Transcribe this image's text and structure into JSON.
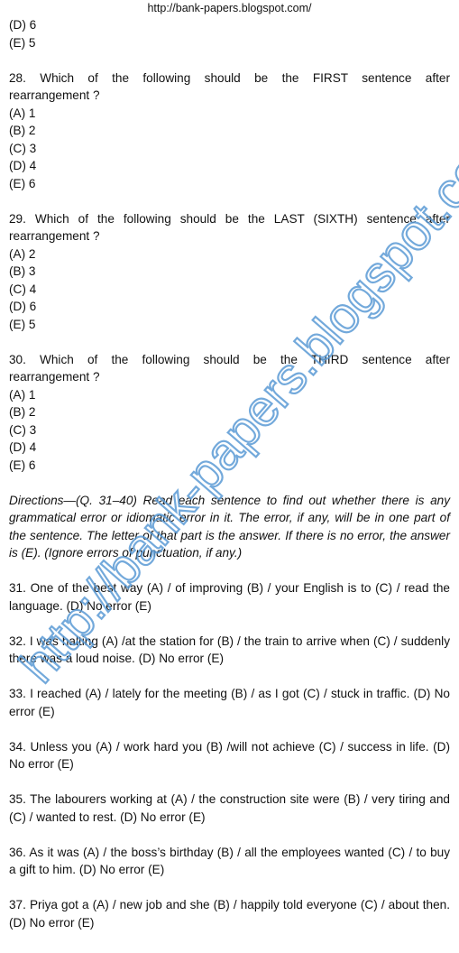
{
  "header": {
    "url": "http://bank-papers.blogspot.com/"
  },
  "prev_options": [
    "(D) 6",
    "(E) 5"
  ],
  "questions_rearrangement": [
    {
      "number": "28.",
      "text_line1": "28. Which of the following should be the FIRST sentence after",
      "text_line2": "rearrangement ?",
      "options": [
        "(A) 1",
        "(B) 2",
        "(C) 3",
        "(D) 4",
        "(E) 6"
      ]
    },
    {
      "number": "29.",
      "text_line1": "29. Which of the following should be the LAST (SIXTH) sentence after",
      "text_line2": "rearrangement ?",
      "options": [
        "(A) 2",
        "(B) 3",
        "(C) 4",
        "(D) 6",
        "(E) 5"
      ]
    },
    {
      "number": "30.",
      "text_line1": "30. Which of the following should be the THIRD sentence after",
      "text_line2": "rearrangement ?",
      "options": [
        "(A) 1",
        "(B) 2",
        "(C) 3",
        "(D) 4",
        "(E) 6"
      ]
    }
  ],
  "directions": "Directions—(Q. 31–40) Read each sentence to find out whether there is any grammatical error or idiomatic error in it. The error, if any, will be in one part of the sentence. The letter of that part is the answer. If there is no error, the answer is (E). (Ignore errors of punctuation, if any.)",
  "error_questions": [
    "31. One of the best way (A) / of improving (B) / your English is to (C) / read the language. (D) No error (E)",
    "32. I was halting (A) /at the station for (B) / the train to arrive when (C) / suddenly there was a loud noise. (D) No error (E)",
    "33. I reached (A) / lately for the meeting (B) / as I got (C) / stuck in traffic. (D) No error (E)",
    "34. Unless you (A) / work hard you (B) /will not achieve (C) / success in life. (D) No error (E)",
    "35. The labourers working at (A) / the construction site were (B) / very tiring and (C) / wanted to rest. (D) No error (E)",
    "36. As it was (A) / the boss’s birthday (B) / all the employees wanted (C) / to buy a gift to him. (D) No error (E)",
    "37. Priya got a (A) / new job and she (B) / happily told everyone (C) / about then. (D) No error (E)"
  ],
  "watermark": {
    "text": "http://bank-papers.blogspot.com/",
    "color": "#5b9bd5"
  }
}
